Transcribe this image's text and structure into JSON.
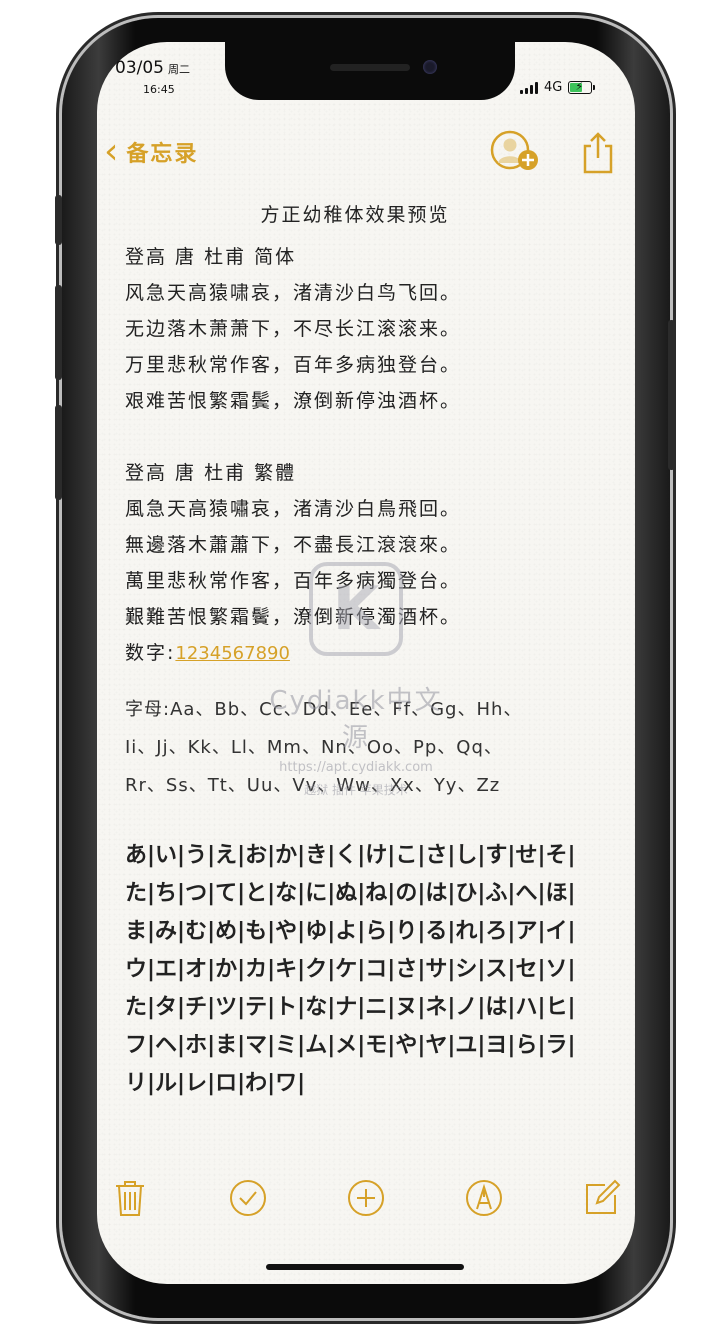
{
  "status": {
    "date": "03/05",
    "weekday": "周二",
    "time": "16:45",
    "network": "4G"
  },
  "nav": {
    "back_label": "备忘录"
  },
  "note": {
    "title": "方正幼稚体效果预览",
    "simplified_heading": "登高 唐 杜甫 简体",
    "simplified_lines": [
      "风急天高猿啸哀，渚清沙白鸟飞回。",
      "无边落木萧萧下，不尽长江滚滚来。",
      "万里悲秋常作客，百年多病独登台。",
      "艰难苦恨繁霜鬓，潦倒新停浊酒杯。"
    ],
    "traditional_heading": "登高 唐 杜甫 繁體",
    "traditional_lines": [
      "風急天高猿嘯哀，渚清沙白鳥飛回。",
      "無邊落木蕭蕭下，不盡長江滾滾來。",
      "萬里悲秋常作客，百年多病獨登台。",
      "艱難苦恨繁霜鬢，潦倒新停濁酒杯。"
    ],
    "numbers_label": "数字:",
    "numbers_value": "1234567890",
    "alphabet_lines": [
      "字母:Aa、Bb、Cc、Dd、Ee、Ff、Gg、Hh、",
      "Ii、Jj、Kk、Ll、Mm、Nn、Oo、Pp、Qq、",
      "Rr、Ss、Tt、Uu、Vv、Ww、Xx、Yy、Zz"
    ],
    "kana_lines": [
      "あ|い|う|え|お|か|き|く|け|こ|さ|し|す|せ|そ|",
      "た|ち|つ|て|と|な|に|ぬ|ね|の|は|ひ|ふ|へ|ほ|",
      "ま|み|む|め|も|や|ゆ|よ|ら|り|る|れ|ろ|ア|イ|",
      "ウ|エ|オ|か|カ|キ|ク|ケ|コ|さ|サ|シ|ス|セ|ソ|",
      "た|タ|チ|ツ|テ|ト|な|ナ|ニ|ヌ|ネ|ノ|は|ハ|ヒ|",
      "フ|ヘ|ホ|ま|マ|ミ|ム|メ|モ|や|ヤ|ユ|ヨ|ら|ラ|",
      "リ|ル|レ|ロ|わ|ワ|"
    ]
  },
  "watermark": {
    "logo": "K",
    "text": "Cydiakk中文源",
    "url": "https://apt.cydiakk.com",
    "sub": "越狱 插件 苹果技术"
  },
  "colors": {
    "accent": "#d6a128",
    "text": "#222222",
    "paper": "#f7f6f2"
  }
}
